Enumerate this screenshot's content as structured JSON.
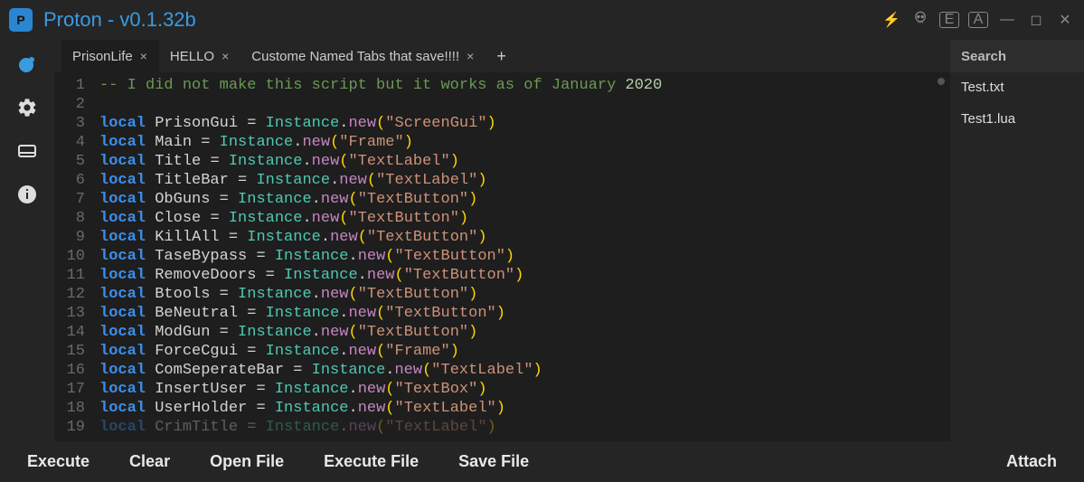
{
  "window": {
    "title": "Proton - v0.1.32b",
    "logo_letter": "P"
  },
  "tabs": [
    {
      "label": "PrisonLife",
      "close": "×",
      "active": true
    },
    {
      "label": "HELLO",
      "close": "×",
      "active": false
    },
    {
      "label": "Custome Named Tabs that save!!!!",
      "close": "×",
      "active": false
    }
  ],
  "add_tab": "+",
  "right": {
    "header": "Search",
    "items": [
      "Test.txt",
      "Test1.lua"
    ]
  },
  "buttons": {
    "execute": "Execute",
    "clear": "Clear",
    "open": "Open File",
    "execute_file": "Execute File",
    "save": "Save File",
    "attach": "Attach"
  },
  "editor": {
    "lines": [
      {
        "n": 1,
        "type": "comment",
        "text": "-- I did not make this script but it works as of January ",
        "year": "2020"
      },
      {
        "n": 2,
        "type": "blank"
      },
      {
        "n": 3,
        "type": "decl",
        "var": "PrisonGui",
        "arg": "ScreenGui"
      },
      {
        "n": 4,
        "type": "decl",
        "var": "Main",
        "arg": "Frame"
      },
      {
        "n": 5,
        "type": "decl",
        "var": "Title",
        "arg": "TextLabel"
      },
      {
        "n": 6,
        "type": "decl",
        "var": "TitleBar",
        "arg": "TextLabel"
      },
      {
        "n": 7,
        "type": "decl",
        "var": "ObGuns",
        "arg": "TextButton"
      },
      {
        "n": 8,
        "type": "decl",
        "var": "Close",
        "arg": "TextButton"
      },
      {
        "n": 9,
        "type": "decl",
        "var": "KillAll",
        "arg": "TextButton"
      },
      {
        "n": 10,
        "type": "decl",
        "var": "TaseBypass",
        "arg": "TextButton"
      },
      {
        "n": 11,
        "type": "decl",
        "var": "RemoveDoors",
        "arg": "TextButton"
      },
      {
        "n": 12,
        "type": "decl",
        "var": "Btools",
        "arg": "TextButton"
      },
      {
        "n": 13,
        "type": "decl",
        "var": "BeNeutral",
        "arg": "TextButton"
      },
      {
        "n": 14,
        "type": "decl",
        "var": "ModGun",
        "arg": "TextButton"
      },
      {
        "n": 15,
        "type": "decl",
        "var": "ForceCgui",
        "arg": "Frame"
      },
      {
        "n": 16,
        "type": "decl",
        "var": "ComSeperateBar",
        "arg": "TextLabel"
      },
      {
        "n": 17,
        "type": "decl",
        "var": "InsertUser",
        "arg": "TextBox"
      },
      {
        "n": 18,
        "type": "decl",
        "var": "UserHolder",
        "arg": "TextLabel"
      },
      {
        "n": 19,
        "type": "decl_faded",
        "var": "CrimTitle",
        "arg": "TextLabel"
      }
    ]
  }
}
